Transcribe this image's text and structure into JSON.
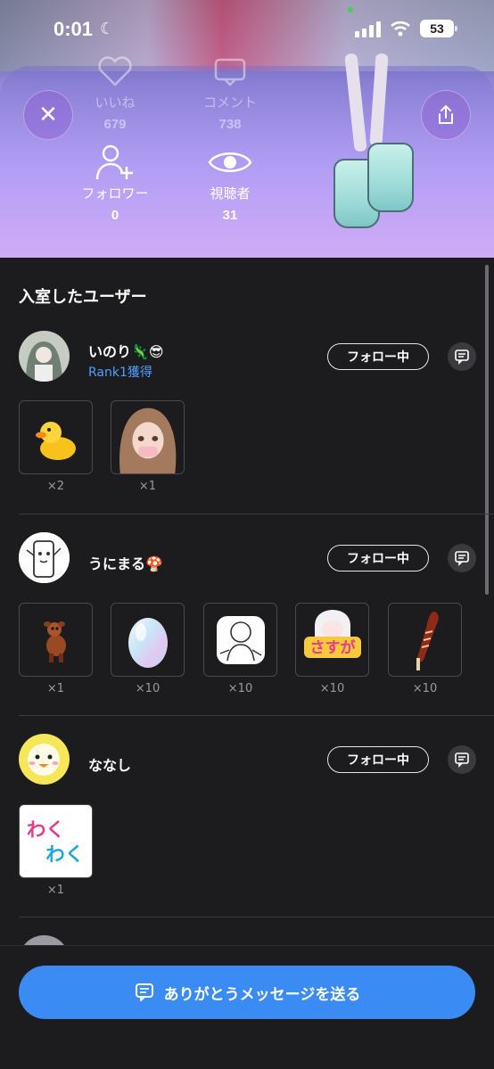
{
  "status_bar": {
    "time": "0:01",
    "battery": "53"
  },
  "stats": {
    "likes": {
      "label": "いいね",
      "value": "679"
    },
    "comments": {
      "label": "コメント",
      "value": "738"
    },
    "followers": {
      "label": "フォロワー",
      "value": "0"
    },
    "viewers": {
      "label": "視聴者",
      "value": "31"
    }
  },
  "list": {
    "title": "入室したユーザー",
    "follow_label": "フォロー中",
    "users": [
      {
        "name": "いのり🦎😎",
        "badge": "Rank1獲得",
        "gifts": [
          {
            "name": "duck",
            "count": "×2"
          },
          {
            "name": "avatar-girl",
            "count": "×1"
          }
        ]
      },
      {
        "name": "うにまる🍄",
        "badge": "",
        "gifts": [
          {
            "name": "deer",
            "count": "×1"
          },
          {
            "name": "egg",
            "count": "×10"
          },
          {
            "name": "sketch-sticker",
            "count": "×10"
          },
          {
            "name": "sasuga-sticker",
            "count": "×10"
          },
          {
            "name": "churros",
            "count": "×10"
          }
        ]
      },
      {
        "name": "ななし",
        "badge": "",
        "gifts": [
          {
            "name": "wakuwaku-sticker",
            "count": "×1"
          }
        ]
      }
    ],
    "sticker_texts": {
      "sasuga": "さすが",
      "waku1": "わく",
      "waku2": "わく"
    }
  },
  "send_button": {
    "label": "ありがとうメッセージを送る"
  },
  "colors": {
    "accent": "#3a8cf4",
    "rank": "#4ea1ff",
    "sheet": "#1c1c1e"
  }
}
